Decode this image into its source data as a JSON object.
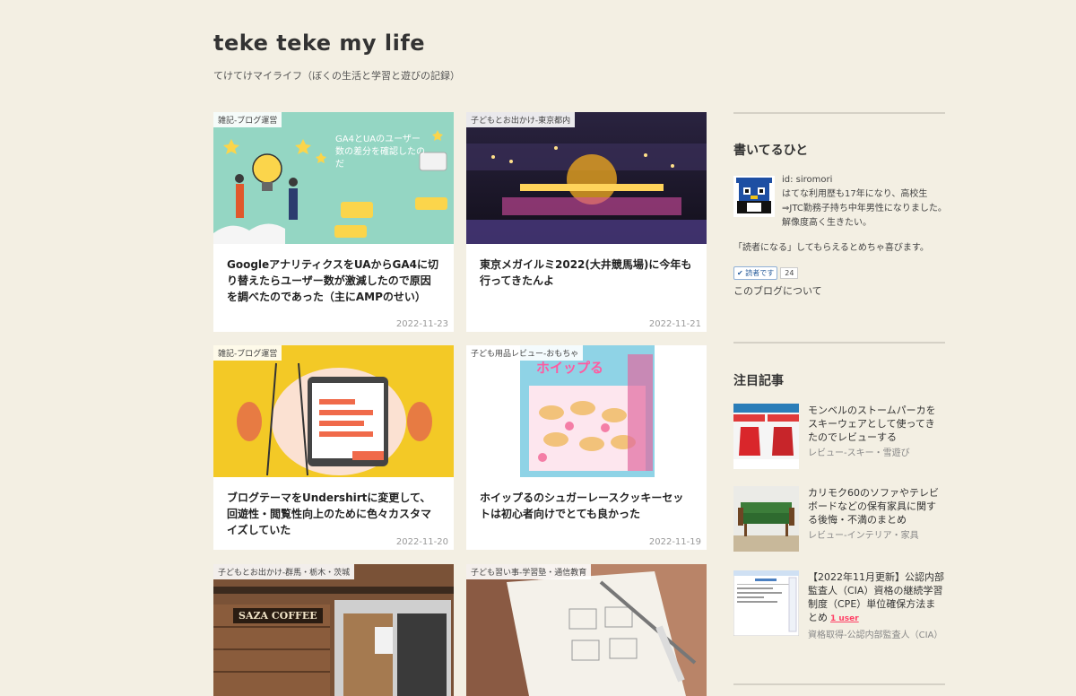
{
  "site": {
    "title": "teke teke my life",
    "description": "てけてけマイライフ（ぼくの生活と学習と遊びの記録）"
  },
  "articles": [
    {
      "category": "雑記-ブログ運営",
      "title": "GoogleアナリティクスをUAからGA4に切り替えたらユーザー数が激減したので原因を調べたのであった（主にAMPのせい）",
      "date": "2022-11-23",
      "thumb_text": "GA4とUAのユーザー数の差分を確認したのだ"
    },
    {
      "category": "子どもとお出かけ-東京都内",
      "title": "東京メガイルミ2022(大井競馬場)に今年も行ってきたんよ",
      "date": "2022-11-21"
    },
    {
      "category": "雑記-ブログ運営",
      "title": "ブログテーマをUndershirtに変更して、回遊性・閲覧性向上のために色々カスタマイズしていた",
      "date": "2022-11-20"
    },
    {
      "category": "子ども用品レビュー-おもちゃ",
      "title": "ホイップるのシュガーレースクッキーセットは初心者向けでとても良かった",
      "date": "2022-11-19",
      "thumb_text": "ホイップる"
    },
    {
      "category": "子どもとお出かけ-群馬・栃木・茨城",
      "title": "",
      "date": "",
      "thumb_text": "SAZA COFFEE"
    },
    {
      "category": "子ども習い事-学習塾・通信教育",
      "title": "",
      "date": ""
    }
  ],
  "sidebar": {
    "profile": {
      "heading": "書いてるひと",
      "id": "id: siromori",
      "bio": "はてな利用歴も17年になり、高校生⇒JTC勤務子持ち中年男性になりました。解像度高く生きたい。",
      "reader_note": "「読者になる」してもらえるとめちゃ喜びます。",
      "reader_button": "読者です",
      "reader_count": "24",
      "about_link": "このブログについて"
    },
    "featured": {
      "heading": "注目記事",
      "items": [
        {
          "title": "モンベルのストームパーカをスキーウェアとして使ってきたのでレビューする",
          "category": "レビュー-スキー・雪遊び",
          "badge": ""
        },
        {
          "title": "カリモク60のソファやテレビボードなどの保有家具に関する後悔・不満のまとめ",
          "category": "レビュー-インテリア・家具",
          "badge": ""
        },
        {
          "title": "【2022年11月更新】公認内部監査人（CIA）資格の継続学習制度（CPE）単位確保方法まとめ",
          "category": "資格取得-公認内部監査人（CIA）",
          "badge": "1 user"
        }
      ]
    }
  },
  "colors": {
    "background": "#f3efe3",
    "card": "#ffffff",
    "accent_link": "#ff4166"
  }
}
